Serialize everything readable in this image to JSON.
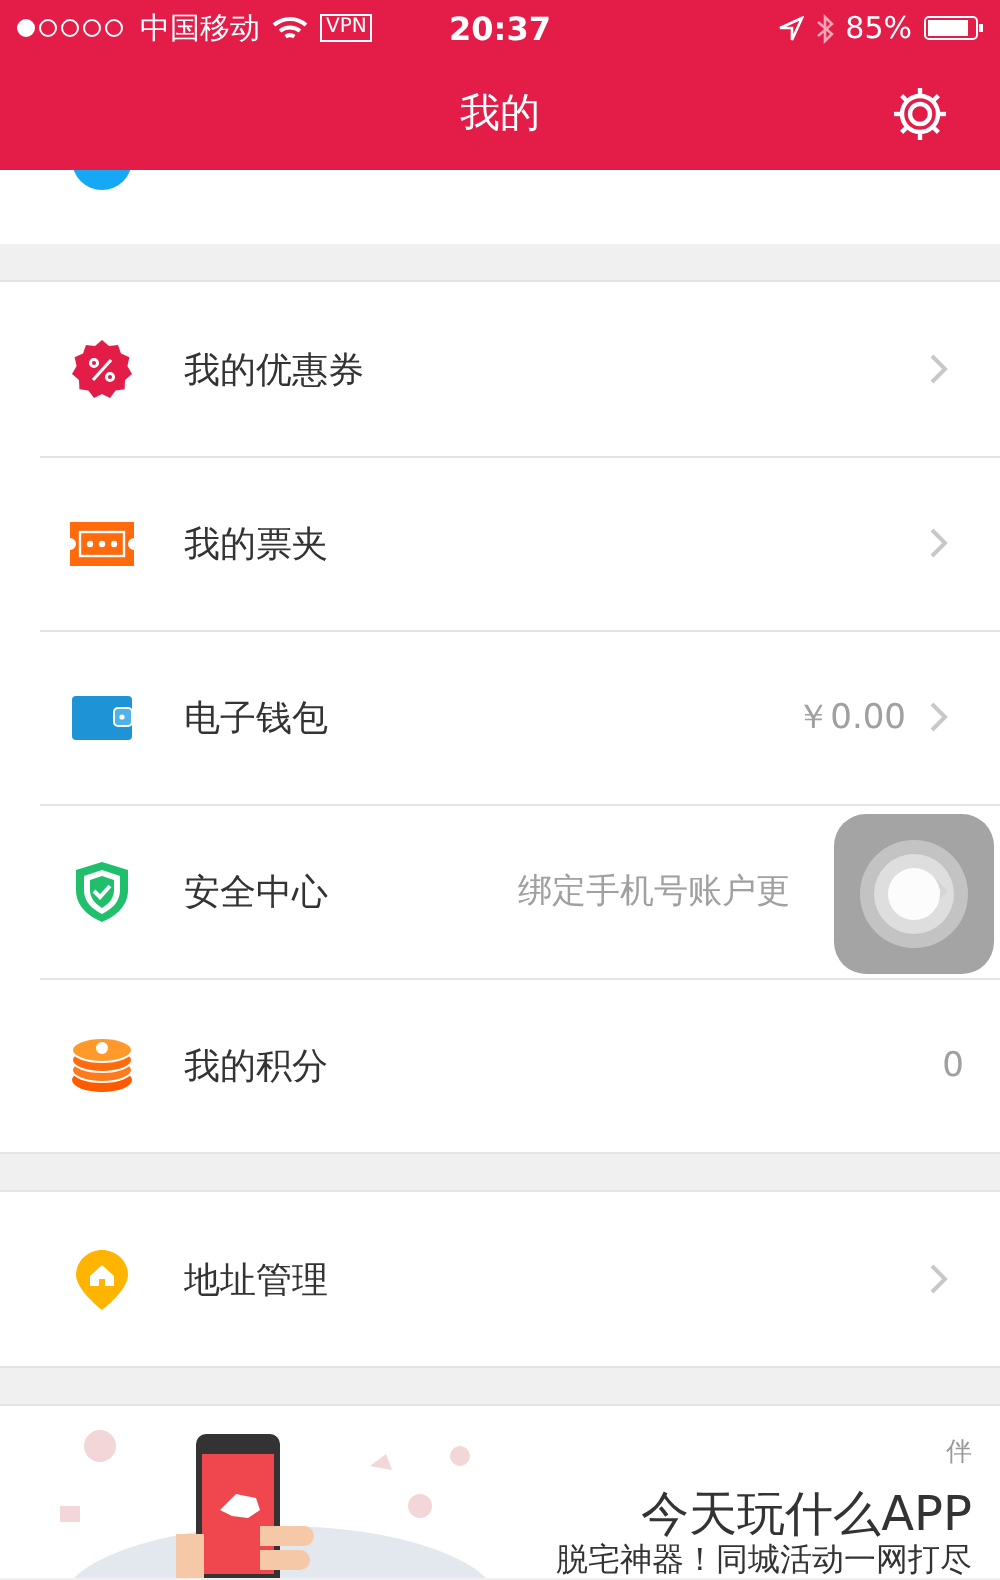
{
  "status_bar": {
    "carrier": "中国移动",
    "vpn": "VPN",
    "time": "20:37",
    "battery": "85%"
  },
  "nav": {
    "title": "我的"
  },
  "groups": [
    {
      "items": [
        {
          "kind": "coupon",
          "label": "我的优惠券",
          "chevron": true
        },
        {
          "kind": "ticket",
          "label": "我的票夹",
          "chevron": true
        },
        {
          "kind": "wallet",
          "label": "电子钱包",
          "value": "￥0.00",
          "chevron": true
        },
        {
          "kind": "shield",
          "label": "安全中心",
          "value": "绑定手机号账户更",
          "chevron": true
        },
        {
          "kind": "coins",
          "label": "我的积分",
          "value": "0",
          "chevron": false
        }
      ]
    },
    {
      "items": [
        {
          "kind": "pin",
          "label": "地址管理",
          "chevron": true
        }
      ]
    }
  ],
  "banner": {
    "kind": "picture",
    "tag": "伴",
    "title": "今天玩什么APP",
    "subtitle": "脱宅神器！同城活动一网打尽"
  }
}
